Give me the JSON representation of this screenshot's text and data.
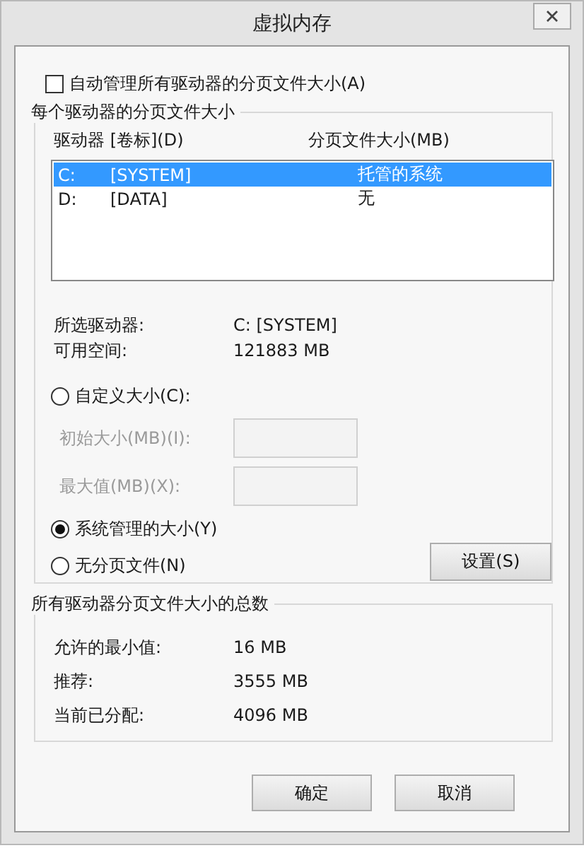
{
  "window": {
    "title": "虚拟内存"
  },
  "auto_manage": {
    "label": "自动管理所有驱动器的分页文件大小(A)",
    "checked": false
  },
  "per_drive": {
    "title": "每个驱动器的分页文件大小",
    "columns": [
      "驱动器 [卷标](D)",
      "分页文件大小(MB)"
    ],
    "drives": [
      {
        "letter": "C:",
        "label": "[SYSTEM]",
        "paging": "托管的系统",
        "selected": true
      },
      {
        "letter": "D:",
        "label": "[DATA]",
        "paging": "无",
        "selected": false
      }
    ],
    "info": [
      {
        "label": "所选驱动器:",
        "value": "C:  [SYSTEM]"
      },
      {
        "label": "可用空间:",
        "value": "121883 MB"
      }
    ],
    "options": [
      {
        "kind": "radio",
        "label": "自定义大小(C):",
        "selected": false
      },
      {
        "kind": "field",
        "label": "初始大小(MB)(I):",
        "disabled": true
      },
      {
        "kind": "field",
        "label": "最大值(MB)(X):",
        "disabled": true
      },
      {
        "kind": "radio",
        "label": "系统管理的大小(Y)",
        "selected": true
      },
      {
        "kind": "radio",
        "label": "无分页文件(N)",
        "selected": false
      }
    ],
    "set_button": "设置(S)"
  },
  "totals": {
    "title": "所有驱动器分页文件大小的总数",
    "rows": [
      {
        "label": "允许的最小值:",
        "value": "16 MB"
      },
      {
        "label": "推荐:",
        "value": "3555 MB"
      },
      {
        "label": "当前已分配:",
        "value": "4096 MB"
      }
    ]
  },
  "buttons": [
    "确定",
    "取消"
  ]
}
